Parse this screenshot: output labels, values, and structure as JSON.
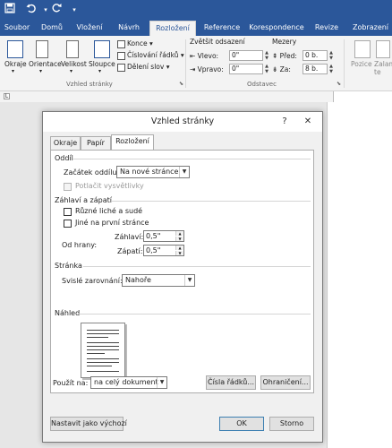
{
  "qat": {
    "save_icon": "floppy-icon",
    "undo_icon": "undo-icon",
    "redo_icon": "redo-icon",
    "customize_icon": "chevron-down-icon"
  },
  "tabs": [
    "Soubor",
    "Domů",
    "Vložení",
    "Návrh",
    "Rozložení",
    "Reference",
    "Korespondence",
    "Revize",
    "Zobrazení"
  ],
  "ribbon": {
    "margins": "Okraje",
    "orientation": "Orientace",
    "size": "Velikost",
    "columns": "Sloupce",
    "breaks": "Konce",
    "line_numbers": "Číslování řádků",
    "hyphenation": "Dělení slov",
    "page_setup_group": "Vzhled stránky",
    "indent_title": "Zvětšit odsazení",
    "indent_left_label": "Vlevo:",
    "indent_left_value": "0\"",
    "indent_right_label": "Vpravo:",
    "indent_right_value": "0\"",
    "spacing_title": "Mezery",
    "spacing_before_label": "Před:",
    "spacing_before_value": "0 b.",
    "spacing_after_label": "Za:",
    "spacing_after_value": "8 b.",
    "paragraph_group": "Odstavec",
    "position": "Pozice",
    "wrap_text": "Zalam te"
  },
  "dialog": {
    "title": "Vzhled stránky",
    "help": "?",
    "close": "✕",
    "tabs": [
      "Okraje",
      "Papír",
      "Rozložení"
    ],
    "section_label": "Oddíl",
    "section_start_label": "Začátek oddílu:",
    "section_start_value": "Na nové stránce",
    "suppress_endnotes": "Potlačit vysvětlivky",
    "headers_footers_label": "Záhlaví a zápatí",
    "different_odd_even": "Různé liché a sudé",
    "different_first_page": "Jiné na první stránce",
    "from_edge_label": "Od hrany:",
    "header_label": "Záhlaví:",
    "header_value": "0,5\"",
    "footer_label": "Zápatí:",
    "footer_value": "0,5\"",
    "page_label": "Stránka",
    "vertical_alignment_label": "Svislé zarovnání:",
    "vertical_alignment_value": "Nahoře",
    "preview_label": "Náhled",
    "apply_to_label": "Použít na:",
    "apply_to_value": "na celý dokument",
    "line_numbers_button": "Čísla řádků...",
    "borders_button": "Ohraničení...",
    "set_default_button": "Nastavit jako výchozí",
    "ok_button": "OK",
    "cancel_button": "Storno"
  }
}
